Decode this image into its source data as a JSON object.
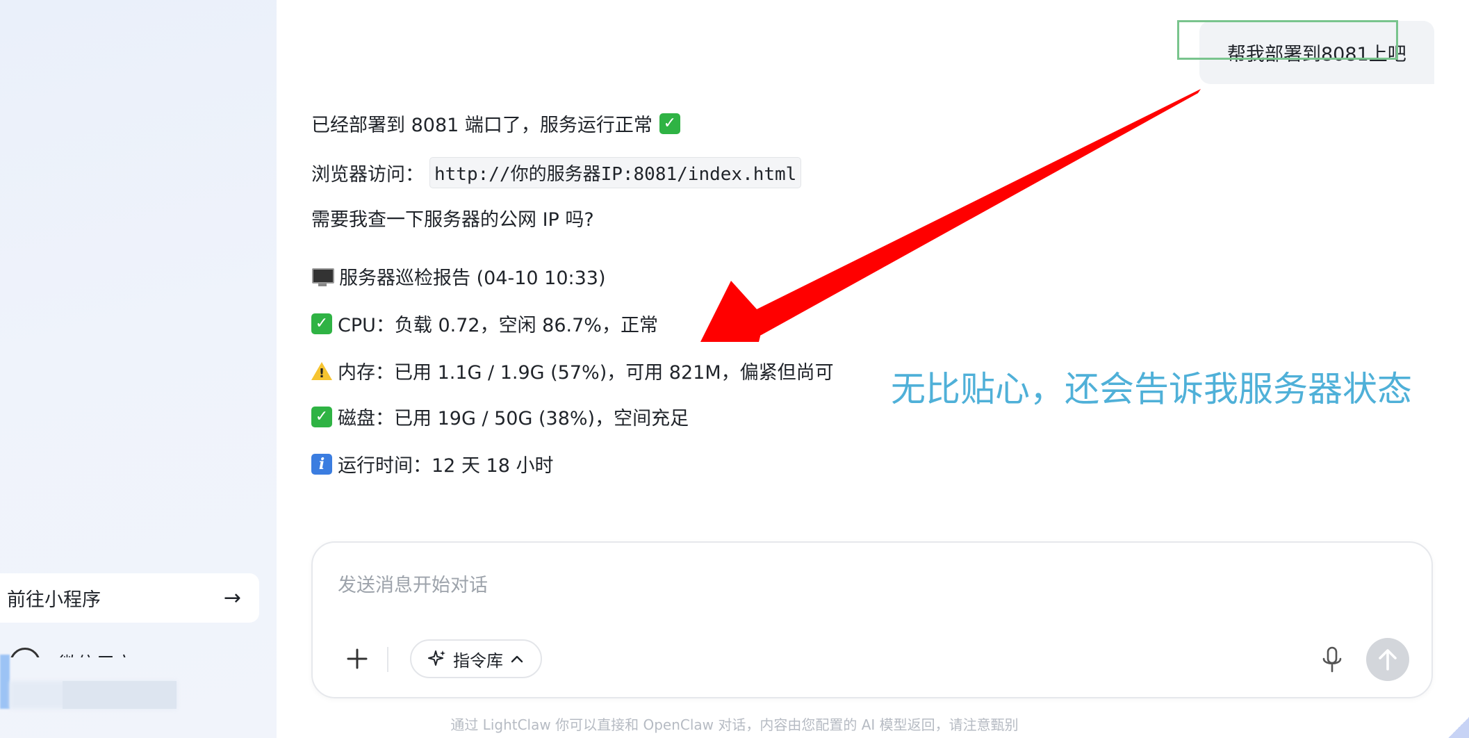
{
  "sidebar": {
    "mini_program_label": "前往小程序",
    "mini_program_arrow": "→",
    "wechat_label": "微信用户"
  },
  "chat": {
    "user_message": "帮我部署到8081上吧",
    "reply_line1": "已经部署到 8081 端口了，服务运行正常",
    "reply_line2_prefix": "浏览器访问：",
    "reply_line2_url": "http://你的服务器IP:8081/index.html",
    "reply_line3": "需要我查一下服务器的公网 IP 吗?",
    "report_title": "服务器巡检报告 (04-10 10:33)",
    "report_cpu": "CPU：负载 0.72，空闲 86.7%，正常",
    "report_mem": "内存：已用 1.1G / 1.9G (57%)，可用 821M，偏紧但尚可",
    "report_disk": "磁盘：已用 19G / 50G (38%)，空间充足",
    "report_uptime": "运行时间：12 天 18 小时"
  },
  "annotation": {
    "text": "无比贴心，还会告诉我服务器状态",
    "text_color": "#4fb0d8",
    "arrow_color": "#ff0000",
    "box_color": "#79c48d"
  },
  "composer": {
    "placeholder": "发送消息开始对话",
    "command_library_label": "指令库",
    "footer_note": "通过 LightClaw 你可以直接和 OpenClaw 对话，内容由您配置的 AI 模型返回，请注意甄别"
  },
  "icons": {
    "check": "check-mark-emoji",
    "warning": "warning-emoji",
    "info": "info-emoji",
    "monitor": "desktop-computer-emoji"
  }
}
